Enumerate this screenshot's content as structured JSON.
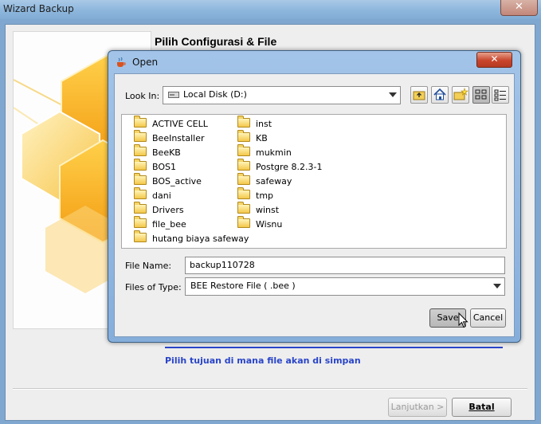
{
  "wizard": {
    "title": "Wizard Backup",
    "close_glyph": "✕",
    "heading": "Pilih Configurasi & File",
    "hint": "Pilih tujuan di mana file akan di simpan",
    "next_label": "Lanjutkan >",
    "cancel_label": "Batal"
  },
  "dialog": {
    "title": "Open",
    "close_glyph": "✕",
    "look_in_label": "Look In:",
    "look_in_value": "Local Disk (D:)",
    "toolbar_icons": [
      "up-folder-icon",
      "home-icon",
      "new-folder-icon",
      "list-view-icon",
      "details-view-icon"
    ],
    "files_col1": [
      "ACTIVE CELL",
      "BeeInstaller",
      "BeeKB",
      "BOS1",
      "BOS_active",
      "dani",
      "Drivers",
      "file_bee",
      "hutang biaya safeway"
    ],
    "files_col2": [
      "inst",
      "KB",
      "mukmin",
      "Postgre 8.2.3-1",
      "safeway",
      "tmp",
      "winst",
      "Wisnu"
    ],
    "file_name_label": "File Name:",
    "file_name_value": "backup110728",
    "file_type_label": "Files of Type:",
    "file_type_value": "BEE Restore File ( .bee )",
    "save_label": "Save",
    "cancel_label": "Cancel"
  }
}
